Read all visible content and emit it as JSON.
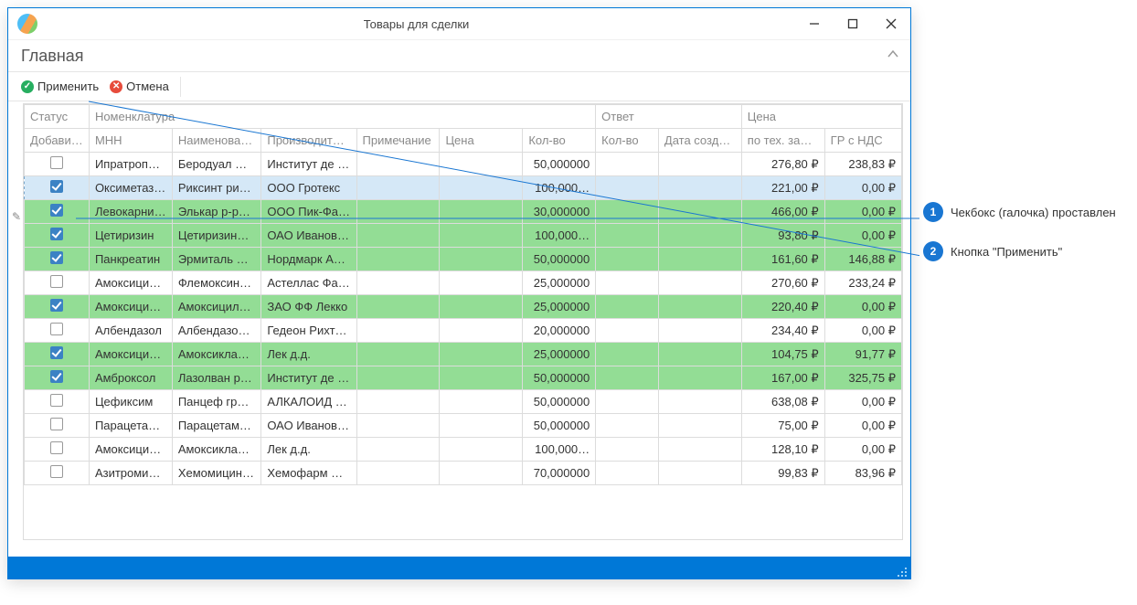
{
  "window": {
    "title": "Товары для сделки"
  },
  "ribbon": {
    "tab_main": "Главная"
  },
  "toolbar": {
    "apply": "Применить",
    "cancel": "Отмена"
  },
  "headers": {
    "group_status": "Статус",
    "group_nomenclature": "Номенклатура",
    "group_response": "Ответ",
    "group_price": "Цена",
    "add": "Добави…",
    "mnn": "МНН",
    "name": "Наименова…",
    "manufacturer": "Производите…",
    "note": "Примечание",
    "price_col": "Цена",
    "qty_col": "Кол-во",
    "resp_qty": "Кол-во",
    "resp_date": "Дата созда…",
    "tech_price": "по тех. за…",
    "gr_nds": "ГР с НДС"
  },
  "rows": [
    {
      "checked": false,
      "green": false,
      "mnn": "Ипратропи…",
      "name": "Беродуал …",
      "mfr": "Институт де …",
      "price": "",
      "qty": "50,000000",
      "tech": "276,80 ₽",
      "gr": "238,83 ₽",
      "selected": false
    },
    {
      "checked": true,
      "green": false,
      "mnn": "Оксиметаз…",
      "name": "Риксинт ри…",
      "mfr": "ООО Гротекс",
      "price": "",
      "qty": "100,000…",
      "tech": "221,00 ₽",
      "gr": "0,00 ₽",
      "selected": true
    },
    {
      "checked": true,
      "green": true,
      "mnn": "Левокарни…",
      "name": "Элькар р-р…",
      "mfr": "ООО Пик-Фа…",
      "price": "",
      "qty": "30,000000",
      "tech": "466,00 ₽",
      "gr": "0,00 ₽",
      "selected": false
    },
    {
      "checked": true,
      "green": true,
      "mnn": "Цетиризин",
      "name": "Цетиризин…",
      "mfr": "ОАО Иванов…",
      "price": "",
      "qty": "100,000…",
      "tech": "93,80 ₽",
      "gr": "0,00 ₽",
      "selected": false
    },
    {
      "checked": true,
      "green": true,
      "mnn": "Панкреатин",
      "name": "Эрмиталь …",
      "mfr": "Нордмарк Ар…",
      "price": "",
      "qty": "50,000000",
      "tech": "161,60 ₽",
      "gr": "146,88 ₽",
      "selected": false
    },
    {
      "checked": false,
      "green": false,
      "mnn": "Амоксицил…",
      "name": "Флемоксин…",
      "mfr": "Астеллас Фа…",
      "price": "",
      "qty": "25,000000",
      "tech": "270,60 ₽",
      "gr": "233,24 ₽",
      "selected": false
    },
    {
      "checked": true,
      "green": true,
      "mnn": "Амоксицил…",
      "name": "Амоксицил…",
      "mfr": "ЗАО ФФ Лекко",
      "price": "",
      "qty": "25,000000",
      "tech": "220,40 ₽",
      "gr": "0,00 ₽",
      "selected": false
    },
    {
      "checked": false,
      "green": false,
      "mnn": "Албендазол",
      "name": "Албендазо…",
      "mfr": "Гедеон Рихт…",
      "price": "",
      "qty": "20,000000",
      "tech": "234,40 ₽",
      "gr": "0,00 ₽",
      "selected": false
    },
    {
      "checked": true,
      "green": true,
      "mnn": "Амоксицил…",
      "name": "Амоксикла…",
      "mfr": "Лек д.д.",
      "price": "",
      "qty": "25,000000",
      "tech": "104,75 ₽",
      "gr": "91,77 ₽",
      "selected": false
    },
    {
      "checked": true,
      "green": true,
      "mnn": "Амброксол",
      "name": "Лазолван р…",
      "mfr": "Институт де …",
      "price": "",
      "qty": "50,000000",
      "tech": "167,00 ₽",
      "gr": "325,75 ₽",
      "selected": false
    },
    {
      "checked": false,
      "green": false,
      "mnn": "Цефиксим",
      "name": "Панцеф гр…",
      "mfr": "АЛКАЛОИД …",
      "price": "",
      "qty": "50,000000",
      "tech": "638,08 ₽",
      "gr": "0,00 ₽",
      "selected": false
    },
    {
      "checked": false,
      "green": false,
      "mnn": "Парацетам…",
      "name": "Парацетам…",
      "mfr": "ОАО Иванов…",
      "price": "",
      "qty": "50,000000",
      "tech": "75,00 ₽",
      "gr": "0,00 ₽",
      "selected": false
    },
    {
      "checked": false,
      "green": false,
      "mnn": "Амоксицил…",
      "name": "Амоксикла…",
      "mfr": "Лек д.д.",
      "price": "",
      "qty": "100,000…",
      "tech": "128,10 ₽",
      "gr": "0,00 ₽",
      "selected": false
    },
    {
      "checked": false,
      "green": false,
      "mnn": "Азитромицин",
      "name": "Хемомицин …",
      "mfr": "Хемофарм А.Д.",
      "price": "",
      "qty": "70,000000",
      "tech": "99,83 ₽",
      "gr": "83,96 ₽",
      "selected": false
    }
  ],
  "callouts": {
    "c1": "Чекбокс (галочка) проставлен",
    "c2": "Кнопка \"Применить\""
  }
}
